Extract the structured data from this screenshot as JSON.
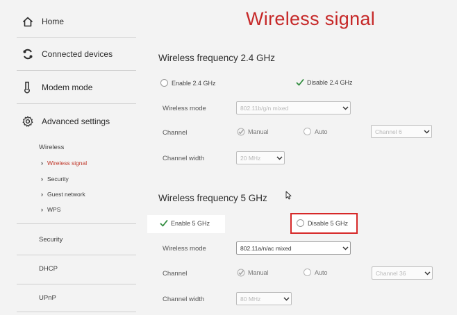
{
  "sidebar": {
    "items": [
      {
        "label": "Home",
        "icon": "home-icon"
      },
      {
        "label": "Connected devices",
        "icon": "connected-devices-icon"
      },
      {
        "label": "Modem mode",
        "icon": "modem-icon"
      },
      {
        "label": "Advanced settings",
        "icon": "gear-icon"
      }
    ],
    "sub_section": "Wireless",
    "sub_items": [
      "Wireless signal",
      "Security",
      "Guest network",
      "WPS"
    ],
    "active_sub_item": "Wireless signal",
    "bottom_items": [
      "Security",
      "DHCP",
      "UPnP"
    ]
  },
  "main": {
    "title": "Wireless signal",
    "band24": {
      "title": "Wireless frequency 2.4 GHz",
      "enable_label": "Enable 2.4 GHz",
      "disable_label": "Disable 2.4 GHz",
      "selected": "disable",
      "wireless_mode_label": "Wireless mode",
      "wireless_mode_value": "802.11b/g/n mixed",
      "channel_label": "Channel",
      "manual_label": "Manual",
      "auto_label": "Auto",
      "channel_value": "Channel 6",
      "channel_width_label": "Channel width",
      "channel_width_value": "20 MHz"
    },
    "band5": {
      "title": "Wireless frequency 5 GHz",
      "enable_label": "Enable 5 GHz",
      "disable_label": "Disable 5 GHz",
      "selected": "enable",
      "wireless_mode_label": "Wireless mode",
      "wireless_mode_value": "802.11a/n/ac mixed",
      "channel_label": "Channel",
      "manual_label": "Manual",
      "auto_label": "Auto",
      "channel_value": "Channel 36",
      "channel_width_label": "Channel width",
      "channel_width_value": "80 MHz"
    }
  },
  "colors": {
    "accent": "#c62828",
    "highlight_box": "#d62828",
    "check_green": "#2e8b3c",
    "background": "#f3f3f3"
  }
}
